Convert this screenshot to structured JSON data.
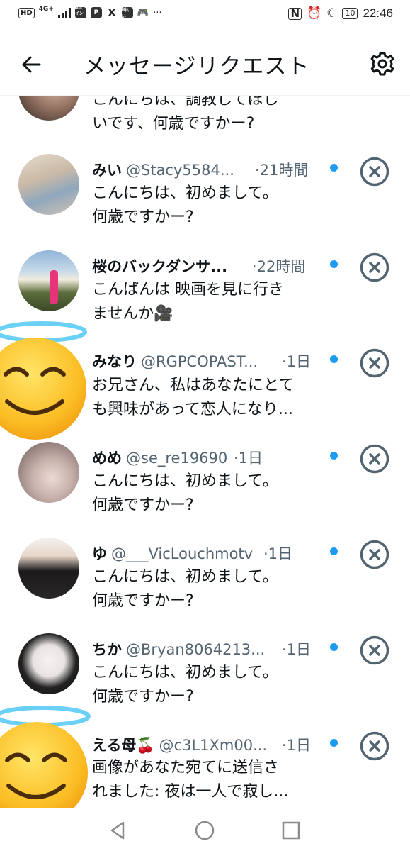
{
  "status_bar": {
    "hd": "HD",
    "network": "4G+",
    "apps": [
      "dポイント",
      "P",
      "X",
      "d払い"
    ],
    "more": "···",
    "icons": [
      "nfc-icon",
      "alarm-icon",
      "moon-icon"
    ],
    "battery": "10",
    "time": "22:46"
  },
  "header": {
    "title": "メッセージリクエスト",
    "back_icon": "arrow-left-icon",
    "settings_icon": "gear-icon"
  },
  "requests": [
    {
      "name": "",
      "handle": "",
      "time": "",
      "message": [
        "こんにちは、調教してほし",
        "いです、何歳ですかー?"
      ],
      "unread": false
    },
    {
      "name": "みい",
      "handle": "@Stacy5584...",
      "time": "·21時間",
      "message": [
        "こんにちは、初めまして。",
        "何歳ですかー?"
      ],
      "unread": true
    },
    {
      "name": "桜のバックダンサ...",
      "handle": "",
      "time": "·22時間",
      "message": [
        "こんばんは 映画を見に行き",
        "ませんか🎥"
      ],
      "unread": true
    },
    {
      "name": "みなり",
      "handle": "@RGPCOPAST...",
      "time": "·1日",
      "message": [
        "お兄さん、私はあなたにとて",
        "も興味があって恋人になり..."
      ],
      "unread": true
    },
    {
      "name": "めめ",
      "handle": "@se_re19690",
      "time": "·1日",
      "message": [
        "こんにちは、初めまして。",
        "何歳ですかー?"
      ],
      "unread": true
    },
    {
      "name": "ゆ",
      "handle": "@___VicLouchmotv",
      "time": "·1日",
      "message": [
        "こんにちは、初めまして。",
        "何歳ですかー?"
      ],
      "unread": true
    },
    {
      "name": "ちか",
      "handle": "@Bryan8064213...",
      "time": "·1日",
      "message": [
        "こんにちは、初めまして。",
        "何歳ですかー?"
      ],
      "unread": true
    },
    {
      "name": "える母🍒",
      "handle": "@c3L1Xm00...",
      "time": "·1日",
      "message": [
        "画像があなた宛てに送信さ",
        "れました: 夜は一人で寂し..."
      ],
      "unread": true
    }
  ],
  "overlay_stickers": [
    "halo-smiling-face-emoji",
    "halo-smiling-face-emoji"
  ],
  "nav_bar": {
    "back": "triangle-back-icon",
    "home": "circle-home-icon",
    "recents": "square-recents-icon"
  },
  "colors": {
    "accent": "#1d9bf0",
    "text": "#0f1419",
    "secondary": "#536471",
    "close_ring": "#536471"
  }
}
